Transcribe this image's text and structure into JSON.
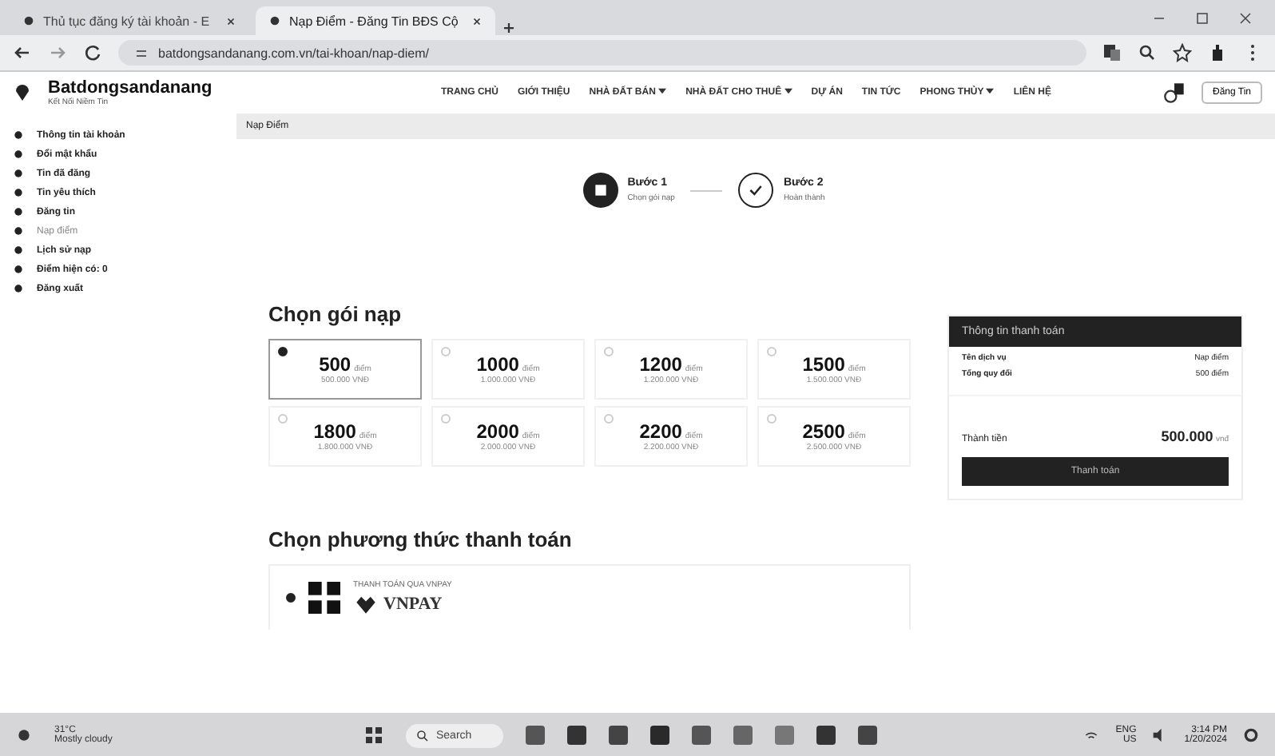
{
  "browser": {
    "tabs": [
      {
        "title": "Thủ tục đăng ký tài khoản - E",
        "selected": false
      },
      {
        "title": "Nạp Điểm - Đăng Tin BĐS Cộ",
        "selected": true
      }
    ],
    "url": "batdongsandanang.com.vn/tai-khoan/nap-diem/"
  },
  "header": {
    "logo": "Batdongsandanang",
    "tagline": "Kết Nối Niềm Tin",
    "nav": [
      {
        "label": "TRANG CHỦ",
        "dropdown": false
      },
      {
        "label": "GIỚI THIỆU",
        "dropdown": false
      },
      {
        "label": "NHÀ ĐẤT BÁN",
        "dropdown": true
      },
      {
        "label": "NHÀ ĐẤT CHO THUÊ",
        "dropdown": true
      },
      {
        "label": "DỰ ÁN",
        "dropdown": false
      },
      {
        "label": "TIN TỨC",
        "dropdown": false
      },
      {
        "label": "PHONG THỦY",
        "dropdown": true
      },
      {
        "label": "LIÊN HỆ",
        "dropdown": false
      }
    ],
    "post_button": "Đăng Tin"
  },
  "sidebar": {
    "items": [
      {
        "label": "Thông tin tài khoản",
        "selected": false
      },
      {
        "label": "Đổi mật khẩu",
        "selected": false
      },
      {
        "label": "Tin đã đăng",
        "selected": false
      },
      {
        "label": "Tin yêu thích",
        "selected": false
      },
      {
        "label": "Đăng tin",
        "selected": false
      },
      {
        "label": "Nạp điểm",
        "selected": true
      },
      {
        "label": "Lịch sử nạp",
        "selected": false
      },
      {
        "label": "Điểm hiện có: 0",
        "selected": false
      },
      {
        "label": "Đăng xuất",
        "selected": false
      }
    ]
  },
  "breadcrumb": "Nạp Điểm",
  "steps": [
    {
      "title": "Bước 1",
      "subtitle": "Chọn gói nạp",
      "done": false
    },
    {
      "title": "Bước 2",
      "subtitle": "Hoàn thành",
      "done": true
    }
  ],
  "packages": {
    "title": "Chọn gói nạp",
    "items": [
      {
        "points": "500",
        "unit": "điểm",
        "price": "500.000 VNĐ",
        "selected": true
      },
      {
        "points": "1000",
        "unit": "điểm",
        "price": "1.000.000 VNĐ",
        "selected": false
      },
      {
        "points": "1200",
        "unit": "điểm",
        "price": "1.200.000 VNĐ",
        "selected": false
      },
      {
        "points": "1500",
        "unit": "điểm",
        "price": "1.500.000 VNĐ",
        "selected": false
      },
      {
        "points": "1800",
        "unit": "điểm",
        "price": "1.800.000 VNĐ",
        "selected": false
      },
      {
        "points": "2000",
        "unit": "điểm",
        "price": "2.000.000 VNĐ",
        "selected": false
      },
      {
        "points": "2200",
        "unit": "điểm",
        "price": "2.200.000 VNĐ",
        "selected": false
      },
      {
        "points": "2500",
        "unit": "điểm",
        "price": "2.500.000 VNĐ",
        "selected": false
      }
    ]
  },
  "payment_methods": {
    "title": "Chọn phương thức thanh toán",
    "items": [
      {
        "label": "THANH TOÁN QUA VNPAY",
        "brand": "VNPAY",
        "selected": true
      }
    ]
  },
  "summary": {
    "title": "Thông tin thanh toán",
    "rows": [
      {
        "label": "Tên dịch vụ",
        "value": "Nạp điểm"
      },
      {
        "label": "Tổng quy đổi",
        "value": "500 điểm"
      }
    ],
    "total_label": "Thành tiền",
    "total": "500.000",
    "currency": "vnđ",
    "pay_button": "Thanh toán"
  },
  "taskbar": {
    "weather": "31°C",
    "weather_desc": "Mostly cloudy",
    "search": "Search",
    "lang": "ENG",
    "region": "US",
    "time": "3:14 PM",
    "date": "1/20/2024"
  }
}
